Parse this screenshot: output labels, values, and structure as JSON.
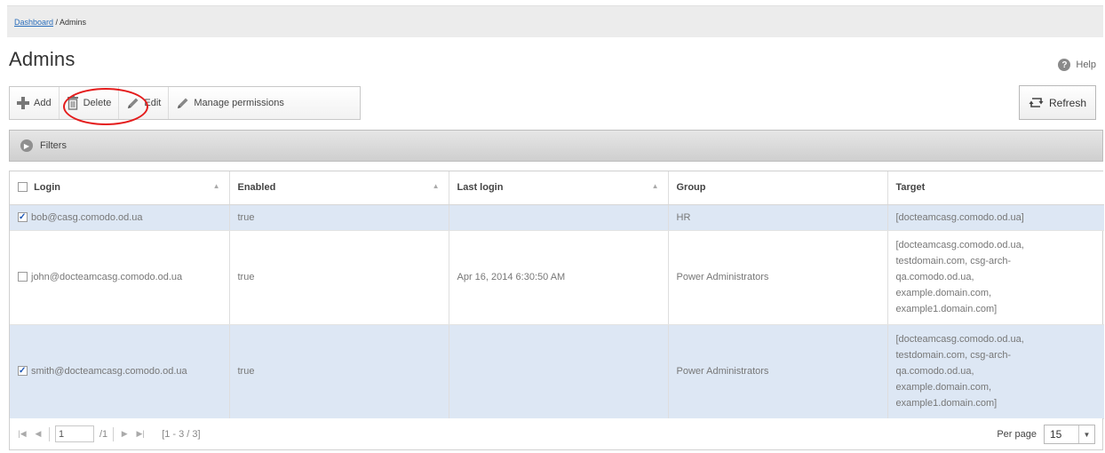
{
  "breadcrumb": {
    "link": "Dashboard",
    "current": " / Admins"
  },
  "page": {
    "title": "Admins",
    "help_label": "Help"
  },
  "toolbar": {
    "add_label": "Add",
    "delete_label": "Delete",
    "edit_label": "Edit",
    "manage_label": "Manage permissions",
    "refresh_label": "Refresh"
  },
  "filters": {
    "label": "Filters"
  },
  "table": {
    "columns": [
      "Login",
      "Enabled",
      "Last login",
      "Group",
      "Target"
    ],
    "rows": [
      {
        "login": "bob@casg.comodo.od.ua",
        "enabled": "true",
        "last_login": "",
        "group": "HR",
        "target": "[docteamcasg.comodo.od.ua]",
        "checked": true
      },
      {
        "login": "john@docteamcasg.comodo.od.ua",
        "enabled": "true",
        "last_login": "Apr 16, 2014 6:30:50 AM",
        "group": "Power Administrators",
        "target": "[docteamcasg.comodo.od.ua, testdomain.com, csg-arch-qa.comodo.od.ua, example.domain.com, example1.domain.com]",
        "checked": false
      },
      {
        "login": "smith@docteamcasg.comodo.od.ua",
        "enabled": "true",
        "last_login": "",
        "group": "Power Administrators",
        "target": "[docteamcasg.comodo.od.ua, testdomain.com, csg-arch-qa.comodo.od.ua, example.domain.com, example1.domain.com]",
        "checked": true
      }
    ]
  },
  "pager": {
    "page_value": "1",
    "page_total": "/1",
    "range": "[1 - 3 / 3]",
    "per_page_label": "Per page",
    "per_page_value": "15"
  },
  "colors": {
    "accent": "#2a6ebb",
    "selected_row": "#dde7f4",
    "highlight_circle": "#e41c1c"
  },
  "icons": {
    "add": "plus-icon",
    "delete": "trash-icon",
    "edit": "pencil-icon",
    "manage": "pencil-icon",
    "refresh": "refresh-icon",
    "help": "help-icon",
    "filters": "arrow-right-circle-icon"
  }
}
